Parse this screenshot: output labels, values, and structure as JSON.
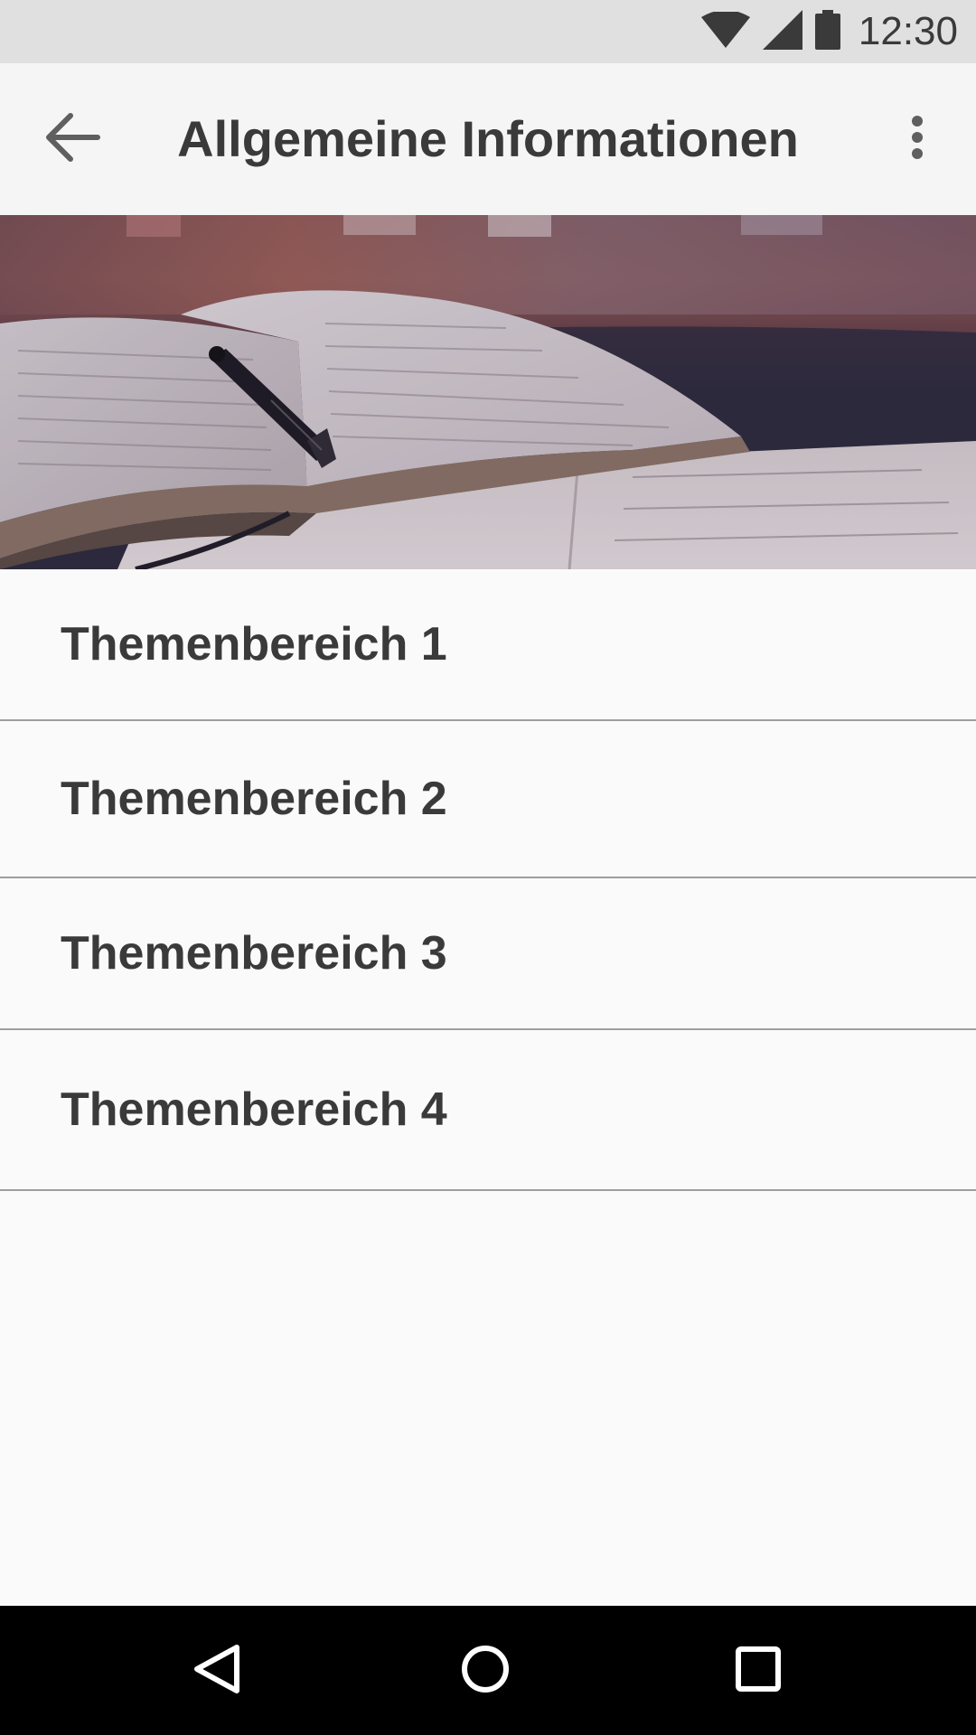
{
  "status_bar": {
    "time": "12:30",
    "icons": [
      "wifi-icon",
      "cell-signal-icon",
      "battery-icon"
    ]
  },
  "app_bar": {
    "title": "Allgemeine Informationen",
    "back_icon": "arrow-back-icon",
    "menu_icon": "more-vert-icon"
  },
  "hero": {
    "image": "open-book-with-pen-photo"
  },
  "topics": [
    {
      "label": "Themenbereich 1"
    },
    {
      "label": "Themenbereich 2"
    },
    {
      "label": "Themenbereich 3"
    },
    {
      "label": "Themenbereich 4"
    }
  ],
  "nav_bar": {
    "icons": [
      "nav-back-icon",
      "nav-home-icon",
      "nav-recents-icon"
    ]
  },
  "colors": {
    "status_bar_bg": "#e0e0e0",
    "app_bar_bg": "#f5f5f5",
    "text": "#3a3a3a",
    "divider": "#9e9e9e",
    "nav_bar_bg": "#000000"
  }
}
